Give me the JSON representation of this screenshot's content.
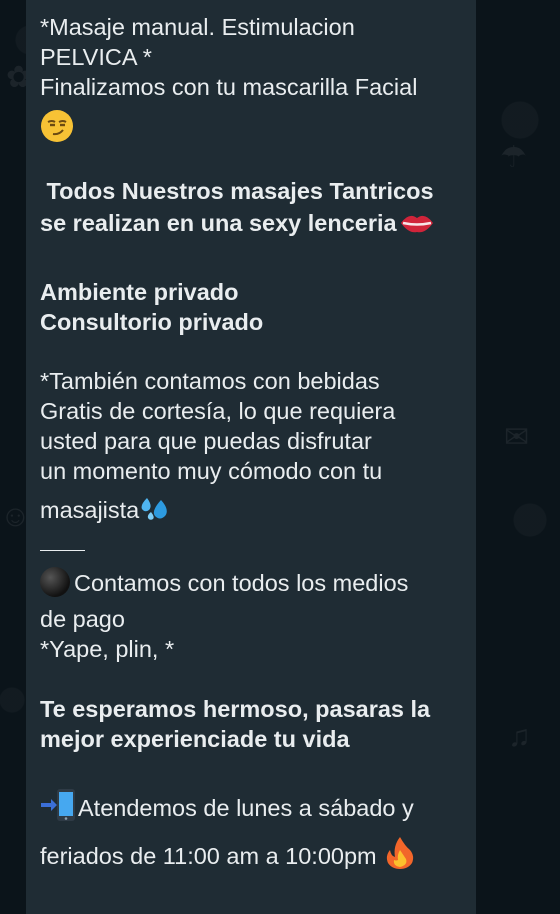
{
  "message": {
    "line1": "*Masaje manual. Estimulacion",
    "line2": "PELVICA *",
    "line3": "Finalizamos con tu mascarilla Facial",
    "tantric_line1": " Todos Nuestros masajes Tantricos",
    "tantric_line2": "se realizan en una sexy lenceria",
    "ambiente_line1": "Ambiente privado",
    "ambiente_line2": "Consultorio privado",
    "bebidas_line1": "*También contamos con bebidas",
    "bebidas_line2": "Gratis de cortesía, lo que requiera",
    "bebidas_line3": "usted para que puedas disfrutar",
    "bebidas_line4": "un momento muy cómodo con tu",
    "bebidas_line5": "masajista",
    "pago_line1": "Contamos con todos los medios",
    "pago_line2": "de pago",
    "pago_line3": "*Yape, plin, *",
    "esperamos_line1": "Te esperamos hermoso, pasaras la",
    "esperamos_line2": "mejor experienciade tu vida",
    "horario_line1": "Atendemos de lunes a sábado y",
    "horario_line2": "feriados de 11:00 am a 10:00pm"
  },
  "icons": {
    "smirk": "smirking-face-icon",
    "lips": "lips-icon",
    "droplets": "sweat-droplets-icon",
    "ball": "black-circle-icon",
    "phone": "mobile-phone-arrow-icon",
    "fire": "fire-icon"
  },
  "colors": {
    "background": "#0b141a",
    "bubble": "#1f2c34",
    "text": "#e9edef"
  }
}
